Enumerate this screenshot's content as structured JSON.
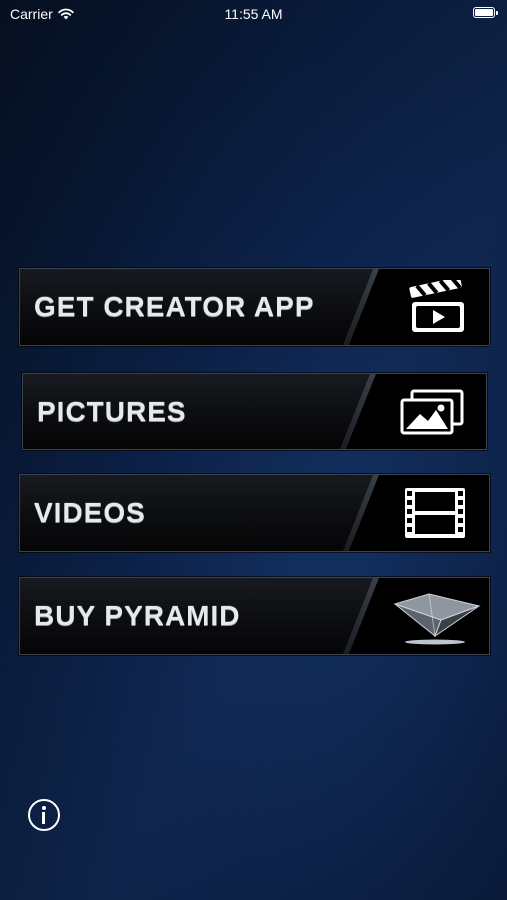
{
  "status_bar": {
    "carrier": "Carrier",
    "time": "11:55 AM",
    "wifi_icon": "wifi-icon",
    "battery_icon": "battery-icon",
    "battery_level": 1.0
  },
  "menu": {
    "items": [
      {
        "label": "GET CREATOR APP",
        "icon": "clapperboard-icon"
      },
      {
        "label": "PICTURES",
        "icon": "pictures-icon"
      },
      {
        "label": "VIDEOS",
        "icon": "film-strip-icon"
      },
      {
        "label": "BUY PYRAMID",
        "icon": "pyramid-icon"
      }
    ]
  },
  "info_button": {
    "icon": "info-icon"
  },
  "colors": {
    "background": "#0b1f45",
    "button_background": "#0c0d10",
    "button_border": "#3a4250",
    "label_color": "#e6e9ee"
  }
}
